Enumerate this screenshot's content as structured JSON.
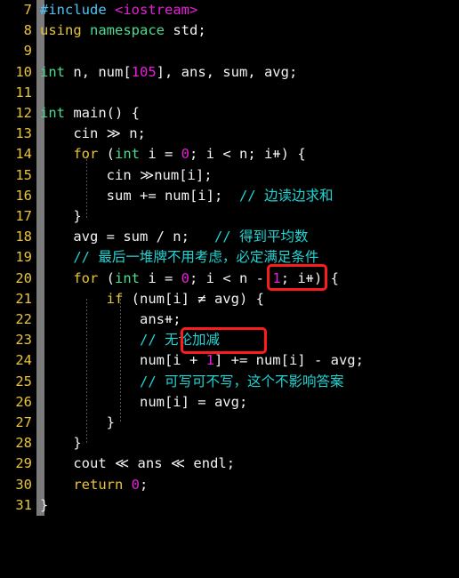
{
  "editor": {
    "background_color": "#000000",
    "line_number_color": "#e8c53a",
    "gutter_marker_color": "#7a7a7a",
    "comment_color": "#21d4d4",
    "keyword_color": "#e8c53a",
    "type_color": "#4ddb92",
    "number_color": "#e91fd8",
    "preprocessor_color": "#4fc3f7",
    "header_color": "#e91fd8",
    "plain_text_color": "#f2f2f2",
    "annotation_color": "#fb1d1d",
    "first_line_number": 7,
    "last_line_number": 31
  },
  "line_numbers": [
    "7",
    "8",
    "9",
    "10",
    "11",
    "12",
    "13",
    "14",
    "15",
    "16",
    "17",
    "18",
    "19",
    "20",
    "21",
    "22",
    "23",
    "24",
    "25",
    "26",
    "27",
    "28",
    "29",
    "30",
    "31"
  ],
  "lines": [
    {
      "n": "7",
      "text": "#include <iostream>"
    },
    {
      "n": "8",
      "text": "using namespace std;"
    },
    {
      "n": "9",
      "text": ""
    },
    {
      "n": "10",
      "text": "int n, num[105], ans, sum, avg;"
    },
    {
      "n": "11",
      "text": ""
    },
    {
      "n": "12",
      "text": "int main() {"
    },
    {
      "n": "13",
      "text": "    cin >> n;"
    },
    {
      "n": "14",
      "text": "    for (int i = 0; i < n; i++) {"
    },
    {
      "n": "15",
      "text": "        cin >>num[i];"
    },
    {
      "n": "16",
      "text": "        sum += num[i];  // 边读边求和"
    },
    {
      "n": "17",
      "text": "    }"
    },
    {
      "n": "18",
      "text": "    avg = sum / n;   // 得到平均数"
    },
    {
      "n": "19",
      "text": "    // 最后一堆牌不用考虑，必定满足条件"
    },
    {
      "n": "20",
      "text": "    for (int i = 0; i < n - 1; i++) {"
    },
    {
      "n": "21",
      "text": "        if (num[i] != avg) {"
    },
    {
      "n": "22",
      "text": "            ans++;"
    },
    {
      "n": "23",
      "text": "            // 无论加减"
    },
    {
      "n": "24",
      "text": "            num[i + 1] += num[i] - avg;"
    },
    {
      "n": "25",
      "text": "            // 可写可不写，这个不影响答案"
    },
    {
      "n": "26",
      "text": "            num[i] = avg;"
    },
    {
      "n": "27",
      "text": "        }"
    },
    {
      "n": "28",
      "text": "    }"
    },
    {
      "n": "29",
      "text": "    cout << ans << endl;"
    },
    {
      "n": "30",
      "text": "    return 0;"
    },
    {
      "n": "31",
      "text": "}"
    }
  ],
  "tokens": {
    "l7_include": "#include",
    "l7_header": "<iostream>",
    "l8_using": "using",
    "l8_namespace": "namespace",
    "l8_std": " std;",
    "l10_int": "int",
    "l10_a": " n, num[",
    "l10_num": "105",
    "l10_b": "], ans, sum, avg;",
    "l12_int": "int",
    "l12_rest": " main() {",
    "l13": "    cin ≫ n;",
    "l14_a": "    ",
    "l14_for": "for",
    "l14_b": " (",
    "l14_int": "int",
    "l14_c": " i = ",
    "l14_zero": "0",
    "l14_d": "; i < n; i⧺) {",
    "l15": "        cin ≫num[i];",
    "l16_code": "        sum += num[i];  ",
    "l16_cmt": "// 边读边求和",
    "l17": "    }",
    "l18_code": "    avg = sum / n;   ",
    "l18_cmt": "// 得到平均数",
    "l19_cmt": "    // 最后一堆牌不用考虑，必定满足条件",
    "l20_a": "    ",
    "l20_for": "for",
    "l20_b": " (",
    "l20_int": "int",
    "l20_c": " i = ",
    "l20_zero": "0",
    "l20_d": "; i < n - ",
    "l20_one": "1",
    "l20_e": "; i⧺) {",
    "l21_a": "        ",
    "l21_if": "if",
    "l21_b": " (num[i] ≠ avg) {",
    "l22": "            ans⧺;",
    "l23_indent": "            ",
    "l23_cmt": "// 无论加减",
    "l24_a": "            num[i + ",
    "l24_one": "1",
    "l24_b": "] += num[i] - avg;",
    "l25_cmt": "            // 可写可不写，这个不影响答案",
    "l26": "            num[i] = avg;",
    "l27": "        }",
    "l28": "    }",
    "l29": "    cout ≪ ans ≪ endl;",
    "l30_a": "    ",
    "l30_return": "return",
    "l30_b": " ",
    "l30_zero": "0",
    "l30_c": ";",
    "l31": "}"
  },
  "annotations": [
    {
      "name": "highlight-n-minus-1",
      "target_text": "n - 1",
      "line": "20"
    },
    {
      "name": "highlight-wulunjiajian",
      "target_text": "无论加减",
      "line": "23"
    }
  ]
}
